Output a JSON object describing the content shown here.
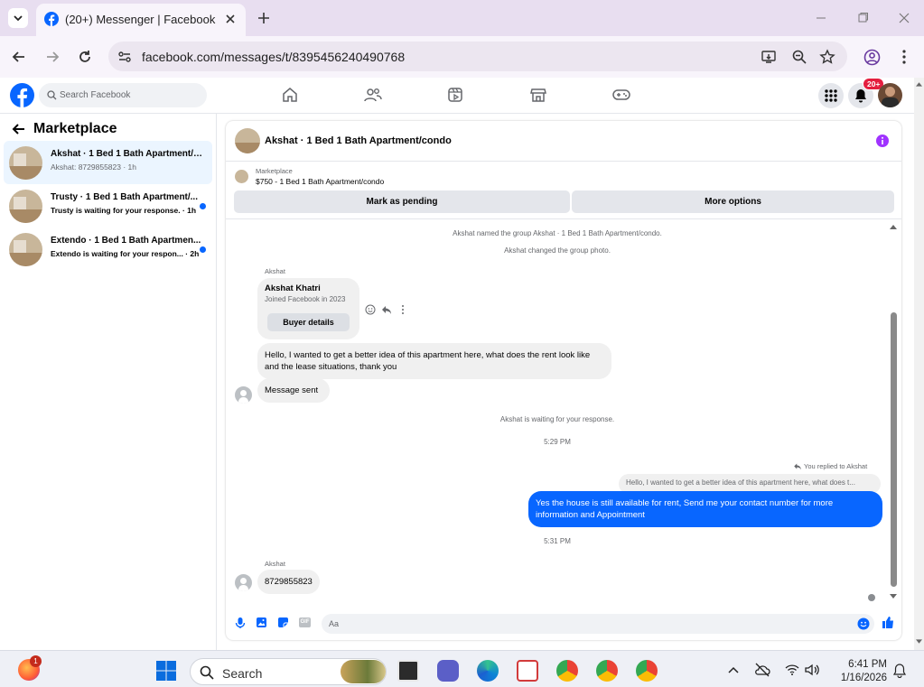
{
  "browser": {
    "tab_title": "(20+) Messenger | Facebook",
    "url": "facebook.com/messages/t/8395456240490768"
  },
  "facebook": {
    "search_placeholder": "Search Facebook",
    "notification_badge": "20+"
  },
  "sidebar": {
    "title": "Marketplace",
    "conversations": [
      {
        "name": "Akshat · 1 Bed 1 Bath Apartment/c...",
        "preview": "Akshat: 8729855823 · 1h",
        "active": true,
        "unread": false
      },
      {
        "name": "Trusty · 1 Bed 1 Bath Apartment/...",
        "preview": "Trusty is waiting for your response. · 1h",
        "active": false,
        "unread": true
      },
      {
        "name": "Extendo · 1 Bed 1 Bath Apartmen...",
        "preview": "Extendo is waiting for your respon... · 2h",
        "active": false,
        "unread": true
      }
    ]
  },
  "chat": {
    "title": "Akshat · 1 Bed 1 Bath Apartment/condo",
    "listing": {
      "label": "Marketplace",
      "description": "$750 - 1 Bed 1 Bath Apartment/condo",
      "pending_button": "Mark as pending",
      "more_button": "More options"
    },
    "system_messages": [
      "Akshat named the group Akshat · 1 Bed 1 Bath Apartment/condo.",
      "Akshat changed the group photo."
    ],
    "profile_card": {
      "sender": "Akshat",
      "name": "Akshat Khatri",
      "joined": "Joined Facebook in 2023",
      "button": "Buyer details"
    },
    "inquiry": "Hello, I wanted to get a better idea of this apartment here, what does the rent look like and the lease situations, thank you",
    "message_sent": "Message sent",
    "waiting": "Akshat is waiting for your response.",
    "time_1": "5:29 PM",
    "replied_label": "You replied to Akshat",
    "quoted": "Hello, I wanted to get a better idea of this apartment here, what does t...",
    "reply": "Yes the house is still available for rent, Send me your contact number for more information and Appointment",
    "time_2": "5:31 PM",
    "last_sender": "Akshat",
    "last_message": "8729855823",
    "composer_placeholder": "Aa"
  },
  "taskbar": {
    "search_label": "Search",
    "time": "6:41 PM",
    "date": "1/16/2026",
    "firefox_badge": "1"
  },
  "colors": {
    "facebook_blue": "#0866ff",
    "messenger_purple": "#a033ff",
    "chrome_tab_bg": "#e8def0"
  }
}
